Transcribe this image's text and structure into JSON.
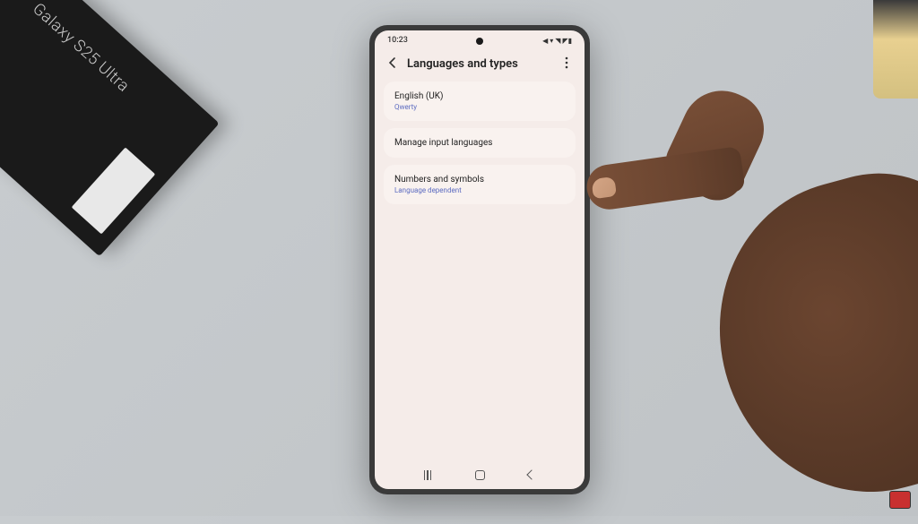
{
  "scene": {
    "product_box_text": "Galaxy S25 Ultra"
  },
  "status_bar": {
    "time": "10:23",
    "icons": "◀ ▾ ◥ ◤▮"
  },
  "header": {
    "title": "Languages and types"
  },
  "cards": {
    "language": {
      "title": "English (UK)",
      "subtitle": "Qwerty"
    },
    "manage": {
      "title": "Manage input languages"
    },
    "numbers": {
      "title": "Numbers and symbols",
      "subtitle": "Language dependent"
    }
  }
}
